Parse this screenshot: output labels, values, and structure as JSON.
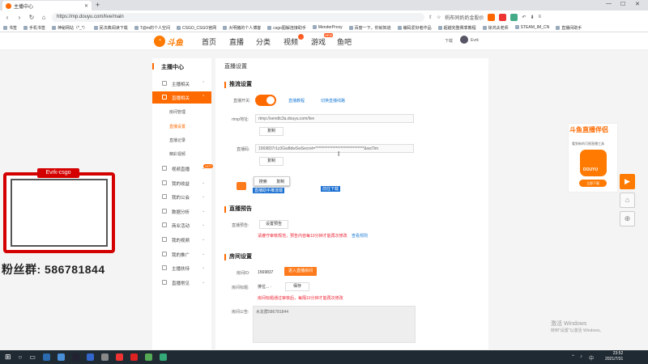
{
  "browser": {
    "tab_title": "主播中心",
    "url": "https://mp.douyu.com/live/main",
    "toolbar_right": "帆布同奶奶金股价",
    "bookmarks": [
      "书签",
      "手机书签",
      "神秘网站（*_*）",
      "民法典阅读下载",
      "T@m的个人空间",
      "CSGO_CSGO官网",
      "大明猪的个人博客",
      "csgo图解连接助手",
      "MenderProxy",
      "百度一下，你就知道",
      "编码爱好者作品",
      "超越完整赛季教程",
      "徐鸿夫老师",
      "STEAM_IM_CN",
      "直播间助手"
    ]
  },
  "site_nav": {
    "logo_text": "斗鱼",
    "links": [
      "首页",
      "直播",
      "分类",
      "视频",
      "游戏",
      "鱼吧"
    ],
    "download": "下载",
    "username": "Evrk"
  },
  "sidebar": {
    "title": "主播中心",
    "group1": "主播相关",
    "active": "直播相关",
    "subs": [
      "房间管理",
      "直播设置",
      "直播记录",
      "精彩视频"
    ],
    "items": [
      "视频直播",
      "我的收益",
      "我的公会",
      "数据分析",
      "商业活动",
      "我的视频",
      "我的推广",
      "主播扶持",
      "直播常见"
    ],
    "hot_tag": "HOT"
  },
  "page": {
    "title": "直播设置",
    "stream": {
      "heading": "推流设置",
      "switch_label": "直播开关:",
      "switch_links": [
        "直播教程",
        "切换直播线路"
      ],
      "rtmp_label": "rtmp地址:",
      "rtmp_value": "rtmp://sendtc3a.douyu.com/live",
      "rtmp_copy": "复制",
      "code_label": "直播码:",
      "code_value": "1569837r1z3Gw8dwSwSecret=*******************************&wsTim",
      "code_copy": "复制",
      "ctx_items": [
        "搜索",
        "复制"
      ],
      "tool_text": "直播助手推流端",
      "tool_link": "前往下载"
    },
    "preview": {
      "heading": "直播预告",
      "label": "直播预告:",
      "button": "设置预告",
      "note": "请遵守审核规范，预告内容每10分钟才能再次修改",
      "note_link": "查看规则"
    },
    "room": {
      "heading": "房间设置",
      "id_label": "房间ID:",
      "id_value": "1569837",
      "id_button": "进入直播房间",
      "title_label": "房间标题:",
      "title_value": "排位... ·",
      "title_button": "保存",
      "title_note": "房间标题通过审核后，每隔10分钟才能再次修改",
      "notice_label": "房间公告:",
      "notice_value": "水友群586781844"
    }
  },
  "overlay": {
    "tag": "Evrk-csgo",
    "fans": "粉丝群: 586781844"
  },
  "ad": {
    "title": "斗鱼直播伴侣",
    "subtitle": "看到新的可视直播工具",
    "app_text": "DOUYU",
    "button": "立即下载"
  },
  "watermark": {
    "line1": "激活 Windows",
    "line2": "转到\"设置\"以激活 Windows。"
  },
  "taskbar": {
    "time": "23:52",
    "date": "2021/7/31"
  },
  "colors": {
    "accent": "#ff6a00",
    "link": "#1e7bd6",
    "overlay_red": "#d40000",
    "taskbar": "#1f2a33"
  }
}
